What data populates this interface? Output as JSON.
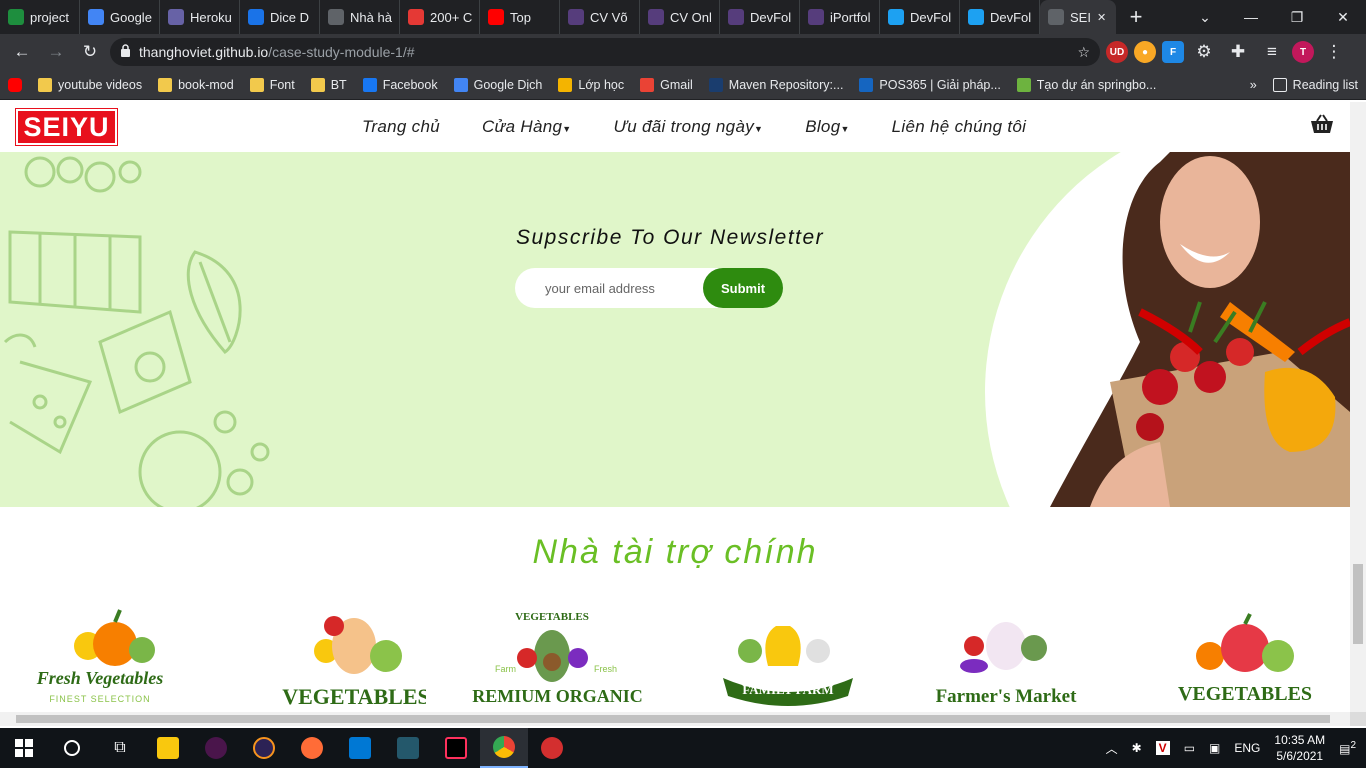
{
  "browser": {
    "tabs": [
      {
        "label": "project",
        "color": "#1e8e3e"
      },
      {
        "label": "Google",
        "color": "#4285f4"
      },
      {
        "label": "Heroku",
        "color": "#6762a6"
      },
      {
        "label": "Dice D",
        "color": "#1a73e8"
      },
      {
        "label": "Nhà hà",
        "color": "#5f6368"
      },
      {
        "label": "200+ C",
        "color": "#e53935"
      },
      {
        "label": "Top",
        "color": "#ff0000"
      },
      {
        "label": "CV Võ",
        "color": "#563d7c"
      },
      {
        "label": "CV Onl",
        "color": "#563d7c"
      },
      {
        "label": "DevFol",
        "color": "#563d7c"
      },
      {
        "label": "iPortfol",
        "color": "#563d7c"
      },
      {
        "label": "DevFol",
        "color": "#1da1f2"
      },
      {
        "label": "DevFol",
        "color": "#1da1f2"
      },
      {
        "label": "SEI",
        "color": "#5f6368",
        "active": true
      }
    ],
    "url_host": "thanghoviet.github.io",
    "url_path": "/case-study-module-1/#",
    "profile_initial": "T",
    "bookmarks": [
      {
        "label": "youtube videos",
        "color": "#f2c94c"
      },
      {
        "label": "book-mod",
        "color": "#f2c94c"
      },
      {
        "label": "Font",
        "color": "#f2c94c"
      },
      {
        "label": "BT",
        "color": "#f2c94c"
      },
      {
        "label": "Facebook",
        "color": "#1877f2"
      },
      {
        "label": "Google Dịch",
        "color": "#4285f4"
      },
      {
        "label": "Lớp học",
        "color": "#f4b400"
      },
      {
        "label": "Gmail",
        "color": "#ea4335"
      },
      {
        "label": "Maven Repository:...",
        "color": "#1a3d6e"
      },
      {
        "label": "POS365 | Giải pháp...",
        "color": "#1565c0"
      },
      {
        "label": "Tạo dự án springbo...",
        "color": "#6db33f"
      }
    ],
    "reading_list": "Reading list"
  },
  "site": {
    "logo": "SEIYU",
    "menu": [
      {
        "label": "Trang chủ",
        "dropdown": false
      },
      {
        "label": "Cửa Hàng",
        "dropdown": true
      },
      {
        "label": "Ưu đãi trong ngày",
        "dropdown": true
      },
      {
        "label": "Blog",
        "dropdown": true
      },
      {
        "label": "Liên hệ chúng tôi",
        "dropdown": false
      }
    ],
    "newsletter": {
      "title": "Supscribe To Our Newsletter",
      "placeholder": "your email address",
      "submit": "Submit"
    },
    "sponsors_title": "Nhà tài trợ chính",
    "sponsors": [
      {
        "name": "Fresh Vegetables",
        "sub": "FINEST SELECTION"
      },
      {
        "name": "VEGETABLES",
        "sub": ""
      },
      {
        "name": "PREMIUM ORGANIC",
        "sub": "VEGETABLES",
        "extra": [
          "Farm",
          "Fresh"
        ]
      },
      {
        "name": "FAMILY FARM",
        "sub": ""
      },
      {
        "name": "Farmer's Market",
        "sub": ""
      },
      {
        "name": "VEGETABLES",
        "sub": ""
      }
    ],
    "colors": {
      "brand": "#e8101d",
      "green": "#6abf25",
      "button": "#2e8b0f",
      "hero_bg": "#e0f6c9"
    }
  },
  "taskbar": {
    "lang": "ENG",
    "time": "10:35 AM",
    "date": "5/6/2021",
    "notifications": "2"
  }
}
